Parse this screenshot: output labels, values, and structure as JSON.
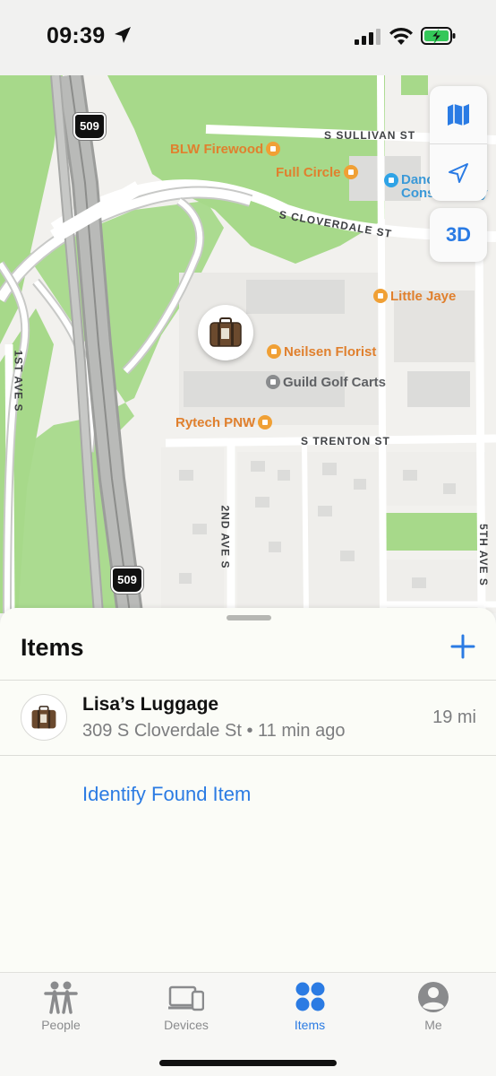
{
  "status_bar": {
    "time": "09:39",
    "icons": [
      "location-arrow-icon",
      "cellular-signal-icon",
      "wifi-icon",
      "battery-charging-icon"
    ],
    "battery_color": "#34c759"
  },
  "map": {
    "highway_shield": "509",
    "streets": {
      "sullivan": "S SULLIVAN ST",
      "cloverdale": "S CLOVERDALE ST",
      "trenton": "S TRENTON ST",
      "first_ave": "1ST AVE S",
      "second_ave": "2ND AVE S",
      "fifth_ave": "5TH AVE S"
    },
    "pois": {
      "blw_firewood": "BLW Firewood",
      "full_circle": "Full Circle",
      "dance": "Dance Conservatory",
      "little_jaye": "Little Jaye",
      "neilsen": "Neilsen Florist",
      "guild": "Guild Golf Carts",
      "rytech": "Rytech PNW"
    },
    "controls": {
      "map_mode_icon": "map-icon",
      "locate_icon": "location-arrow-icon",
      "three_d": "3D"
    },
    "pin_icon": "luggage-icon"
  },
  "sheet": {
    "title": "Items",
    "add_icon": "plus-icon",
    "items": [
      {
        "name": "Lisa’s Luggage",
        "address": "309 S Cloverdale St • 11 min ago",
        "distance": "19 mi",
        "icon": "luggage-icon"
      }
    ],
    "identify_link": "Identify Found Item"
  },
  "tab_bar": {
    "tabs": [
      {
        "label": "People",
        "icon": "people-icon",
        "active": false
      },
      {
        "label": "Devices",
        "icon": "devices-icon",
        "active": false
      },
      {
        "label": "Items",
        "icon": "items-grid-icon",
        "active": true
      },
      {
        "label": "Me",
        "icon": "person-circle-icon",
        "active": false
      }
    ]
  },
  "colors": {
    "accent": "#2b7be3",
    "map_park_green": "#a7d98a",
    "poi_orange": "#e0802e"
  }
}
